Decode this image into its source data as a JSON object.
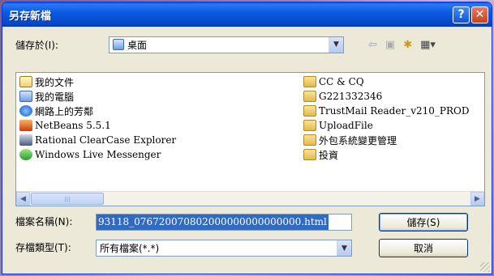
{
  "dialog": {
    "title": "另存新檔"
  },
  "toolbar": {
    "save_in_label": "儲存於(I):",
    "location": "桌面",
    "location_icon": "desktop-icon"
  },
  "files": {
    "left": [
      {
        "label": "我的文件",
        "icon": "my-documents-icon"
      },
      {
        "label": "我的電腦",
        "icon": "my-computer-icon"
      },
      {
        "label": "網路上的芳鄰",
        "icon": "network-places-icon"
      },
      {
        "label": "NetBeans 5.5.1",
        "icon": "netbeans-icon"
      },
      {
        "label": "Rational ClearCase Explorer",
        "icon": "clearcase-icon"
      },
      {
        "label": "Windows Live Messenger",
        "icon": "messenger-icon"
      }
    ],
    "right": [
      {
        "label": "CC & CQ",
        "icon": "folder-icon"
      },
      {
        "label": "G221332346",
        "icon": "folder-icon"
      },
      {
        "label": "TrustMail Reader_v210_PROD",
        "icon": "folder-icon"
      },
      {
        "label": "UploadFile",
        "icon": "folder-icon"
      },
      {
        "label": "外包系統變更管理",
        "icon": "folder-icon"
      },
      {
        "label": "投資",
        "icon": "folder-icon"
      }
    ]
  },
  "filename": {
    "label": "檔案名稱(N):",
    "value": "93118_076720070802000000000000000.html"
  },
  "filetype": {
    "label": "存檔類型(T):",
    "value": "所有檔案(*.*)"
  },
  "buttons": {
    "save": "儲存(S)",
    "cancel": "取消"
  },
  "colors": {
    "titlebar": "#0b5ce2",
    "selection": "#316ac5",
    "face": "#ece9d8"
  }
}
